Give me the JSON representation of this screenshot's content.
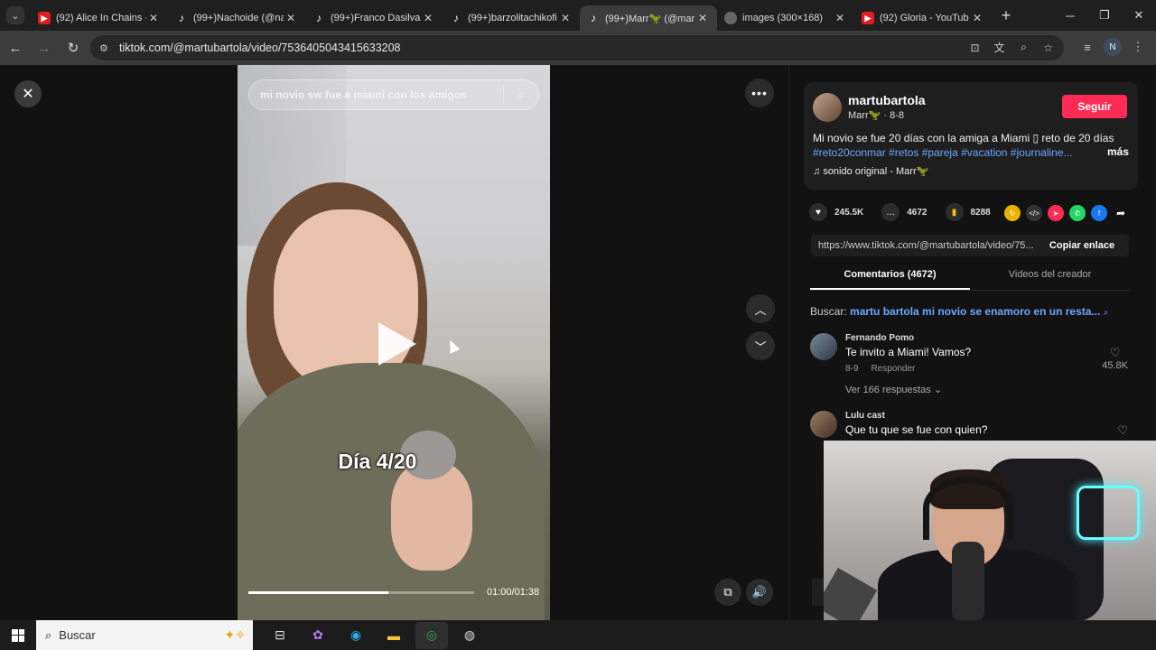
{
  "browser": {
    "tabs": [
      {
        "label": "(92) Alice In Chains -",
        "icon": "youtube-icon",
        "active": false
      },
      {
        "label": "(99+)Nachoide (@na",
        "icon": "tiktok-icon",
        "active": false
      },
      {
        "label": "(99+)Franco Dasilva",
        "icon": "tiktok-icon",
        "active": false
      },
      {
        "label": "(99+)barzolitachikofi",
        "icon": "tiktok-icon",
        "active": false
      },
      {
        "label": "(99+)Marr🦖 (@mar",
        "icon": "tiktok-icon",
        "active": true
      },
      {
        "label": "images (300×168)",
        "icon": "globe-icon",
        "active": false
      },
      {
        "label": "(92) Gloria - YouTub",
        "icon": "youtube-icon",
        "active": false
      }
    ],
    "url": "tiktok.com/@martubartola/video/7536405043415633208",
    "profile_initial": "N"
  },
  "video": {
    "search_query": "mi novio sw fue a miami con los amigos",
    "caption": "Día 4/20",
    "time": "01:00/01:38",
    "progress": 0.62
  },
  "panel": {
    "username": "martubartola",
    "display_name": "Marr🦖",
    "date": "8-8",
    "follow_label": "Seguir",
    "description": "Mi novio se fue 20 días con la amiga a Miami ▯ reto de 20 días",
    "hashtags": "#reto20conmar #retos #pareja #vacation #journaline...",
    "more_label": "más",
    "sound": "sonido original - Marr🦖",
    "likes": "245.5K",
    "comments": "4672",
    "saves": "8288",
    "link": "https://www.tiktok.com/@martubartola/video/75...",
    "copy_label": "Copiar enlace",
    "tab_comments": "Comentarios (4672)",
    "tab_creator": "Videos del creador",
    "search_prefix": "Buscar:",
    "search_suggestion": "martu bartola mi novio se enamoro en un resta...",
    "comment_list": [
      {
        "user": "Fernando Pomo",
        "text": "Te invito a Miami! Vamos?",
        "date": "8-9",
        "reply": "Responder",
        "likes": "45.8K",
        "replies": "Ver 166 respuestas"
      },
      {
        "user": "Lulu cast",
        "text": "Que tu que se fue con quien?"
      }
    ]
  },
  "taskbar": {
    "search_placeholder": "Buscar"
  },
  "colors": {
    "accent": "#fe2c55",
    "link": "#6ea8ff"
  }
}
